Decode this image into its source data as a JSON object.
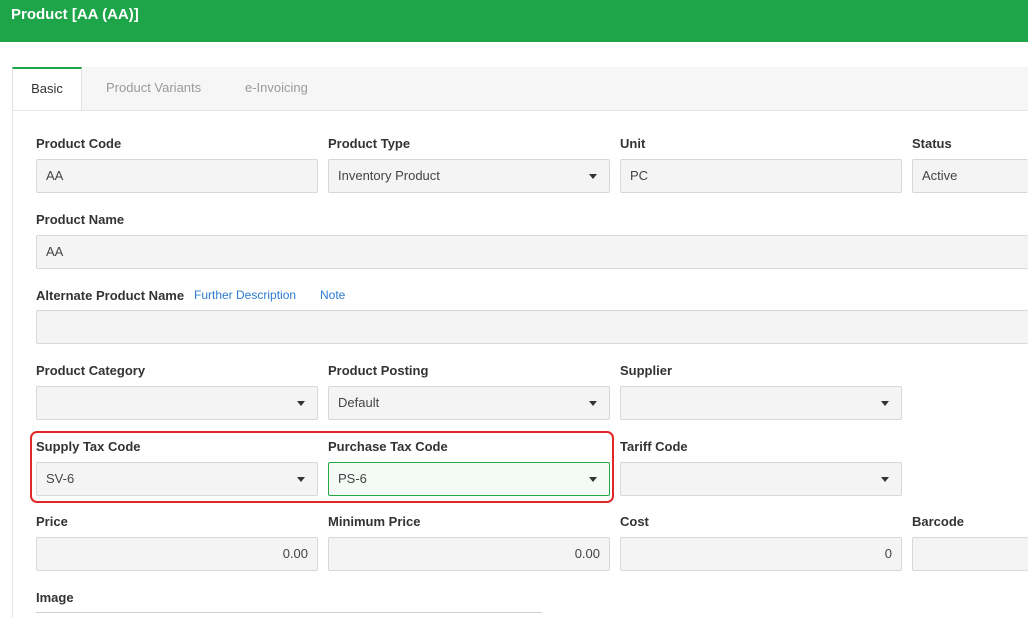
{
  "header": {
    "title": "Product [AA (AA)]"
  },
  "tabs": [
    {
      "label": "Basic",
      "active": true
    },
    {
      "label": "Product Variants",
      "active": false
    },
    {
      "label": "e-Invoicing",
      "active": false
    }
  ],
  "form": {
    "product_code": {
      "label": "Product Code",
      "value": "AA"
    },
    "product_type": {
      "label": "Product Type",
      "value": "Inventory Product"
    },
    "unit": {
      "label": "Unit",
      "value": "PC"
    },
    "status": {
      "label": "Status",
      "value": "Active"
    },
    "product_name": {
      "label": "Product Name",
      "value": "AA"
    },
    "alternate_name": {
      "label": "Alternate Product Name",
      "value": "",
      "further_description_link": "Further Description",
      "note_link": "Note"
    },
    "product_category": {
      "label": "Product Category",
      "value": ""
    },
    "product_posting": {
      "label": "Product Posting",
      "value": "Default"
    },
    "supplier": {
      "label": "Supplier",
      "value": ""
    },
    "supply_tax_code": {
      "label": "Supply Tax Code",
      "value": "SV-6"
    },
    "purchase_tax_code": {
      "label": "Purchase Tax Code",
      "value": "PS-6"
    },
    "tariff_code": {
      "label": "Tariff Code",
      "value": ""
    },
    "price": {
      "label": "Price",
      "value": "0.00"
    },
    "minimum_price": {
      "label": "Minimum Price",
      "value": "0.00"
    },
    "cost": {
      "label": "Cost",
      "value": "0"
    },
    "barcode": {
      "label": "Barcode",
      "value": ""
    },
    "image": {
      "label": "Image"
    }
  },
  "colors": {
    "header_bg": "#1ea54a",
    "highlight": "#e02828",
    "link": "#2d7bd0"
  }
}
